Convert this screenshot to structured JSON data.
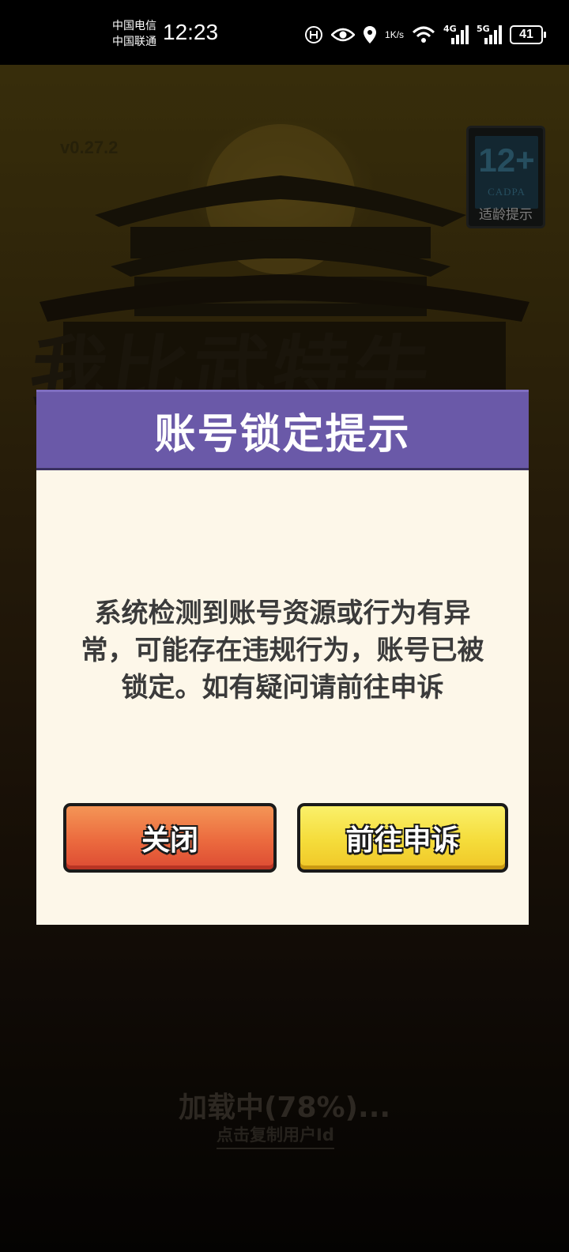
{
  "status_bar": {
    "carrier_1": "中国电信",
    "carrier_2": "中国联通",
    "time": "12:23",
    "net_speed_value": "1",
    "net_speed_unit": "K/s",
    "signal_1_label": "4G",
    "signal_2_label": "5G",
    "battery": "41",
    "icons": [
      "hd-call-icon",
      "eye-icon",
      "location-icon",
      "wifi-icon",
      "signal-icon",
      "battery-icon"
    ]
  },
  "game": {
    "version": "v0.27.2",
    "age_rating": {
      "number": "12+",
      "org": "CADPA",
      "tip": "适龄提示"
    },
    "title_art": "我比武特牛",
    "loading_text": "加载中(78%)...",
    "loading_progress_percent": 78,
    "copy_user_id": "点击复制用户Id"
  },
  "dialog": {
    "title": "账号锁定提示",
    "message": "系统检测到账号资源或行为有异常，可能存在违规行为，账号已被锁定。如有疑问请前往申诉",
    "close_button": "关闭",
    "appeal_button": "前往申诉",
    "colors": {
      "header": "#6a59a8",
      "body": "#fdf7e9",
      "close": "#eb6a3e",
      "appeal": "#f5dc3a"
    }
  }
}
